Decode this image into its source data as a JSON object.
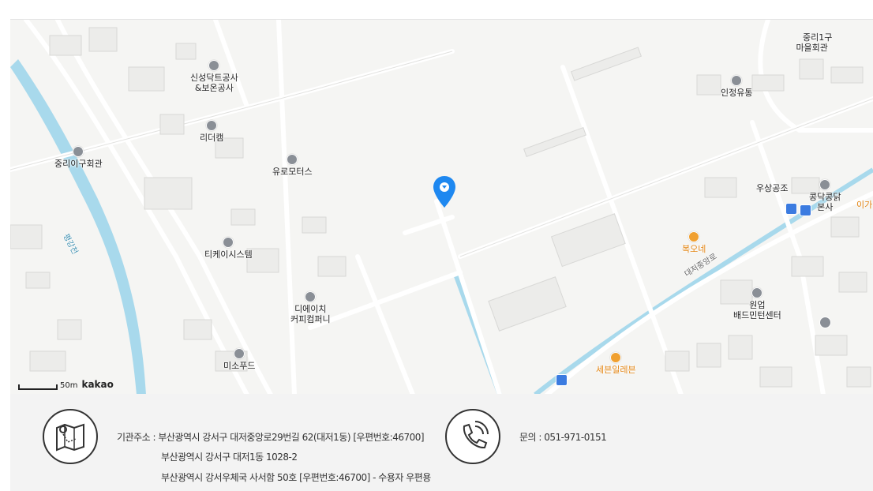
{
  "map": {
    "scale_label": "50m",
    "brand": "kakao",
    "river_label": "평강천",
    "road_label": "대저중앙로",
    "edge_label": "이가",
    "pois": [
      {
        "id": "sinseong",
        "name": "신성닥트공사\n&보온공사",
        "color": "gray"
      },
      {
        "id": "jungri1gu",
        "name": "중리1구\n마을회관",
        "color": "gray"
      },
      {
        "id": "injeong",
        "name": "인정유통",
        "color": "gray"
      },
      {
        "id": "leader",
        "name": "리더캠",
        "color": "gray"
      },
      {
        "id": "jungri2",
        "name": "중리이구회관",
        "color": "gray"
      },
      {
        "id": "euro",
        "name": "유로모터스",
        "color": "gray"
      },
      {
        "id": "kongdak",
        "name": "콩닥콩닭\n본사",
        "color": "gray"
      },
      {
        "id": "usang",
        "name": "우상공조",
        "color": "gray"
      },
      {
        "id": "tk",
        "name": "티케이시스템",
        "color": "gray"
      },
      {
        "id": "bokone",
        "name": "복오네",
        "color": "orange"
      },
      {
        "id": "dh",
        "name": "디에이치\n커피컴퍼니",
        "color": "gray"
      },
      {
        "id": "wonup",
        "name": "원업\n배드민턴센터",
        "color": "gray"
      },
      {
        "id": "miso",
        "name": "미소푸드",
        "color": "gray"
      },
      {
        "id": "seven",
        "name": "세븐일레븐",
        "color": "orange"
      }
    ]
  },
  "footer": {
    "address_lines": [
      "기관주소 : 부산광역시 강서구 대저중앙로29번길 62(대저1동) [우편번호:46700]",
      "부산광역시 강서구 대저1동 1028-2",
      "부산광역시 강서우체국 사서함 50호 [우편번호:46700] - 수용자 우편용"
    ],
    "contact": "문의 : 051-971-0151",
    "icons": {
      "address": "map-icon",
      "phone": "phone-icon"
    }
  }
}
